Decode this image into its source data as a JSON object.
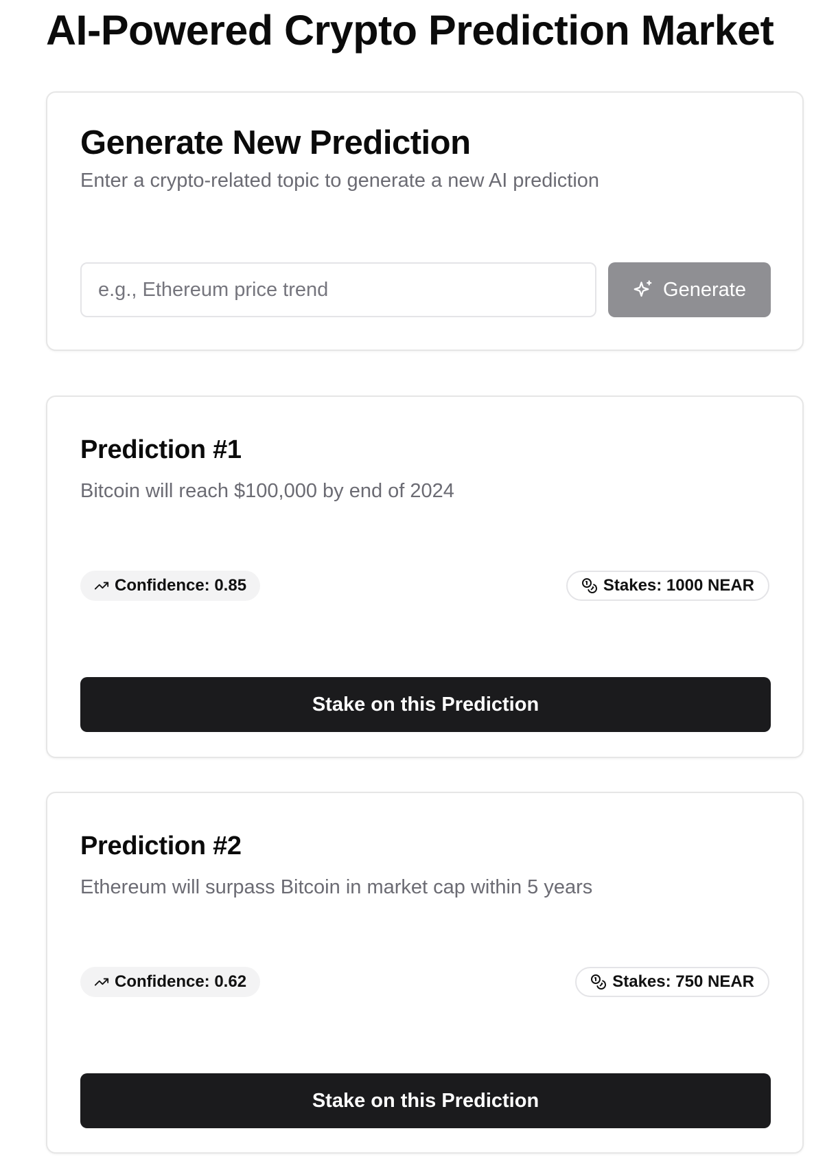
{
  "header": {
    "title": "AI-Powered Crypto Prediction Market"
  },
  "generator": {
    "title": "Generate New Prediction",
    "description": "Enter a crypto-related topic to generate a new AI prediction",
    "input_value": "",
    "input_placeholder": "e.g., Ethereum price trend",
    "button_label": "Generate",
    "button_icon": "sparkles-icon",
    "button_color": "#8f8f93"
  },
  "predictions": [
    {
      "title": "Prediction #1",
      "text": "Bitcoin will reach $100,000 by end of 2024",
      "confidence": "Confidence: 0.85",
      "confidence_icon": "trending-up-icon",
      "stakes": "Stakes: 1000 NEAR",
      "stakes_icon": "coins-icon",
      "stake_button": "Stake on this Prediction"
    },
    {
      "title": "Prediction #2",
      "text": "Ethereum will surpass Bitcoin in market cap within 5 years",
      "confidence": "Confidence: 0.62",
      "confidence_icon": "trending-up-icon",
      "stakes": "Stakes: 750 NEAR",
      "stakes_icon": "coins-icon",
      "stake_button": "Stake on this Prediction"
    }
  ],
  "colors": {
    "primary_button": "#1b1b1d",
    "muted_text": "#6b6b73",
    "border": "#e4e4e7",
    "badge_bg": "#f3f3f4"
  }
}
